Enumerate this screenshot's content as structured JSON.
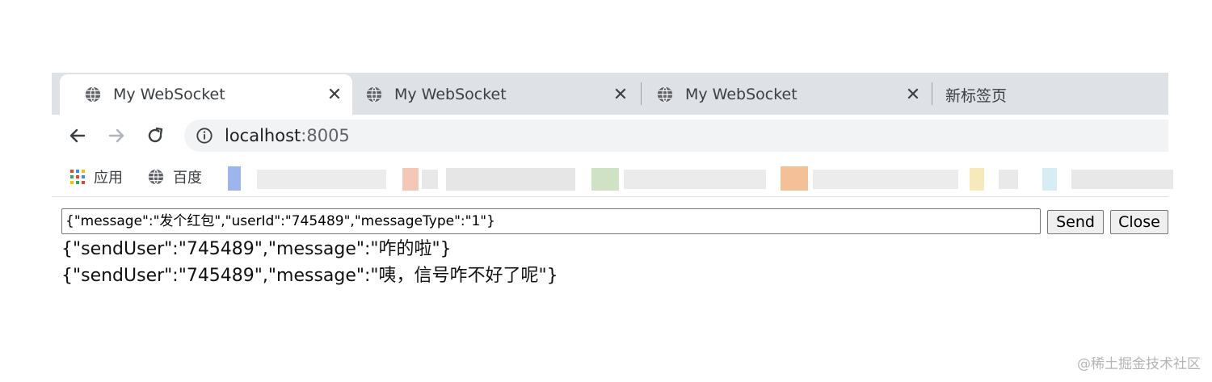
{
  "tabs": [
    {
      "title": "My WebSocket",
      "icon": "globe-icon",
      "active": true
    },
    {
      "title": "My WebSocket",
      "icon": "globe-icon",
      "active": false
    },
    {
      "title": "My WebSocket",
      "icon": "globe-icon",
      "active": false
    },
    {
      "title": "新标签页",
      "active": false
    }
  ],
  "tab_close_glyph": "✕",
  "address_bar": {
    "host": "localhost",
    "port": ":8005"
  },
  "bookmarks": [
    {
      "label": "应用",
      "icon": "apps-grid-icon"
    },
    {
      "label": "百度",
      "icon": "globe-icon"
    }
  ],
  "page": {
    "input_value": "{\"message\":\"发个红包\",\"userId\":\"745489\",\"messageType\":\"1\"}",
    "send_label": "Send",
    "close_label": "Close",
    "log": [
      "{\"sendUser\":\"745489\",\"message\":\"咋的啦\"}",
      "{\"sendUser\":\"745489\",\"message\":\"咦，信号咋不好了呢\"}"
    ]
  },
  "watermark": "@稀土掘金技术社区",
  "colors": {
    "tabstrip": "#dee1e6",
    "omnibox": "#f1f3f4",
    "text": "#3c4043"
  }
}
